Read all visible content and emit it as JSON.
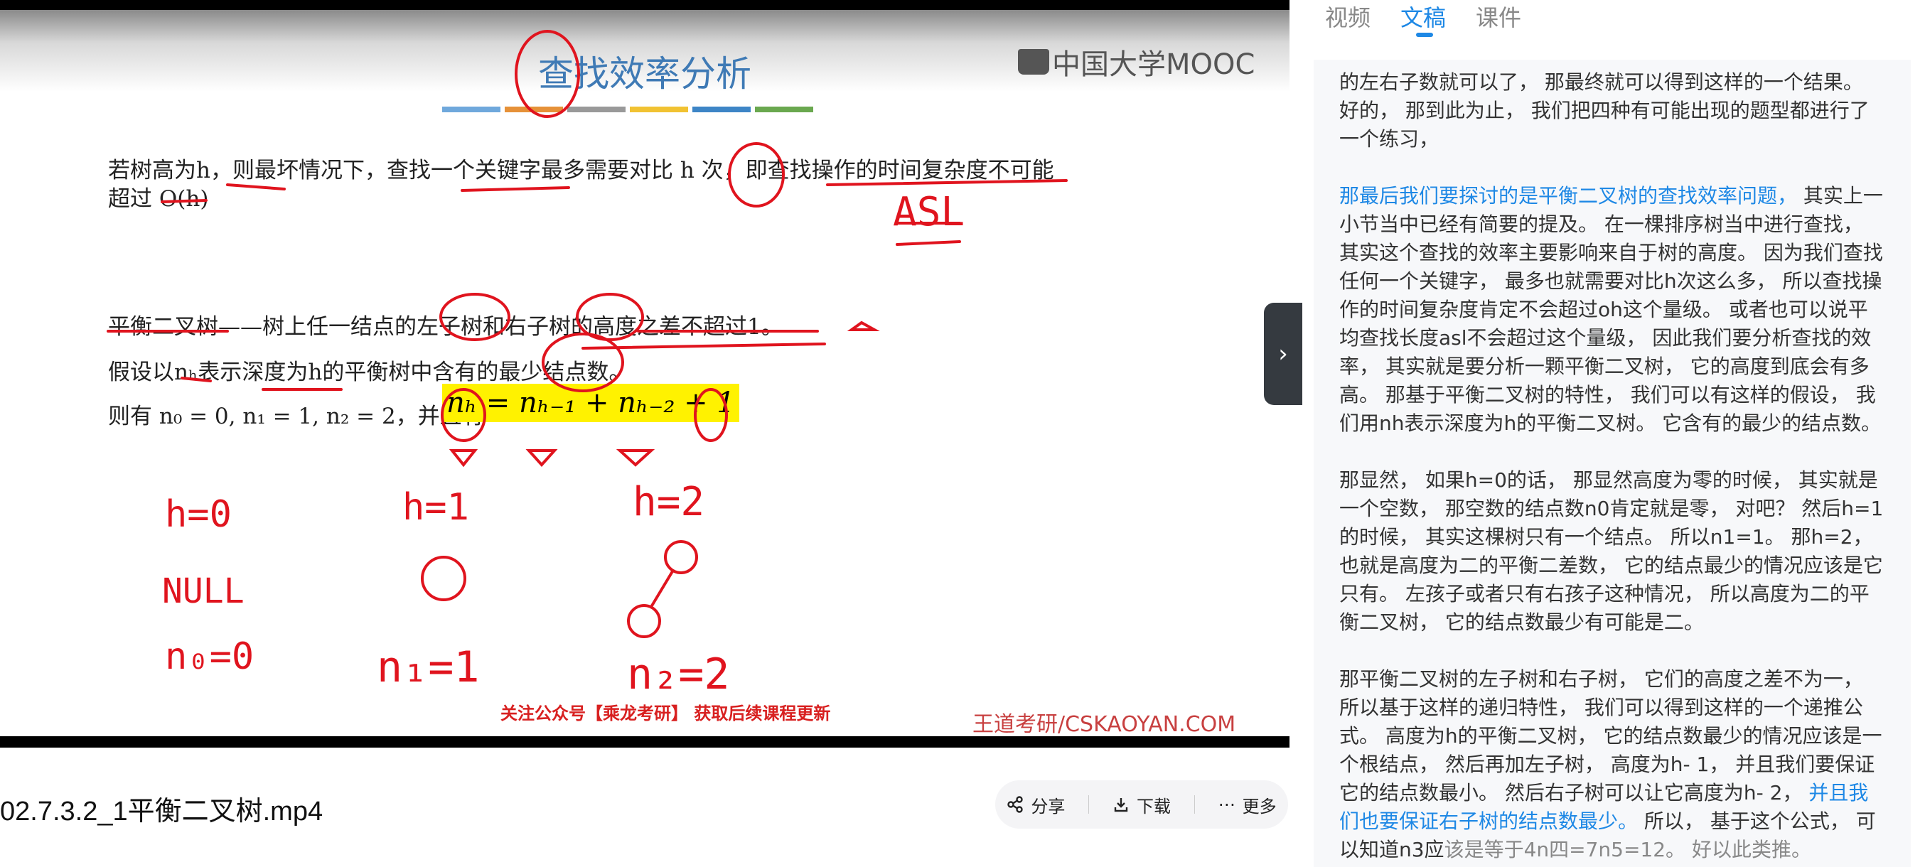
{
  "slide": {
    "title": "查找效率分析",
    "logo": "中国大学MOOC",
    "line1": "若树高为h，则最坏情况下，查找一个关键字最多需要对比 h 次，即查找操作的时间复杂度不可能",
    "line2": "超过 O(h)",
    "line3": "平衡二叉树——树上任一结点的左子树和右子树的高度之差不超过1。",
    "line4": "假设以nₕ表示深度为h的平衡树中含有的最少结点数。",
    "line5_prefix": "则有 n₀ = 0, n₁ = 1, n₂ = 2，并且有",
    "formula": "nₕ = nₕ₋₁ + nₕ₋₂ + 1",
    "footer_promo": "关注公众号【乘龙考研】 获取后续课程更新",
    "footer_brand": "王道考研/CSKAOYAN.COM",
    "handwriting": [
      "ASL",
      "h=0",
      "NULL",
      "n₀=0",
      "h=1",
      "n₁=1",
      "h=2",
      "n₂=2"
    ]
  },
  "video": {
    "filename": "02.7.3.2_1平衡二叉树.mp4",
    "actions": {
      "share": "分享",
      "download": "下载",
      "more": "更多"
    }
  },
  "panel": {
    "tabs": [
      "视频",
      "文稿",
      "课件"
    ],
    "active_tab": "文稿",
    "paragraphs": [
      {
        "text": "的左右子数就可以了， 那最终就可以得到这样的一个结果。 好的， 那到此为止， 我们把四种有可能出现的题型都进行了一个练习，"
      },
      {
        "highlight": "那最后我们要探讨的是平衡二叉树的查找效率问题，",
        "text": " 其实上一小节当中已经有简要的提及。 在一棵排序树当中进行查找， 其实这个查找的效率主要影响来自于树的高度。 因为我们查找任何一个关键字， 最多也就需要对比h次这么多， 所以查找操作的时间复杂度肯定不会超过oh这个量级。 或者也可以说平均查找长度asl不会超过这个量级， 因此我们要分析查找的效率， 其实就是要分析一颗平衡二叉树， 它的高度到底会有多高。 那基于平衡二叉树的特性， 我们可以有这样的假设， 我们用nh表示深度为h的平衡二叉树。 它含有的最少的结点数。"
      },
      {
        "text": "那显然， 如果h=0的话， 那显然高度为零的时候， 其实就是一个空数， 那空数的结点数n0肯定就是零， 对吧？ 然后h=1的时候， 其实这棵树只有一个结点。 所以n1=1。 那h=2， 也就是高度为二的平衡二差数， 它的结点最少的情况应该是它只有。 左孩子或者只有右孩子这种情况， 所以高度为二的平衡二叉树， 它的结点数最少有可能是二。"
      },
      {
        "text": "那平衡二叉树的左子树和右子树， 它们的高度之差不为一， 所以基于这样的递归特性， 我们可以得到这样的一个递推公式。 高度为h的平衡二叉树， 它的结点数最少的情况应该是一个根结点， 然后再加左子树， 高度为h- 1， 并且我们要保证它的结点数最小。 然后右子树可以让它高度为h- 2，",
        "highlight_tail": " 并且我们也要保证右子树的结点数最少。",
        "tail": " 所以， 基于这个公式， 可以知道n3应",
        "grey": "该是等于4n四=7n5=12。 好以此类推。"
      }
    ]
  },
  "colors": {
    "accent": "#1e88e5",
    "ink": "#e0141e",
    "formula_bg": "#fff200"
  }
}
